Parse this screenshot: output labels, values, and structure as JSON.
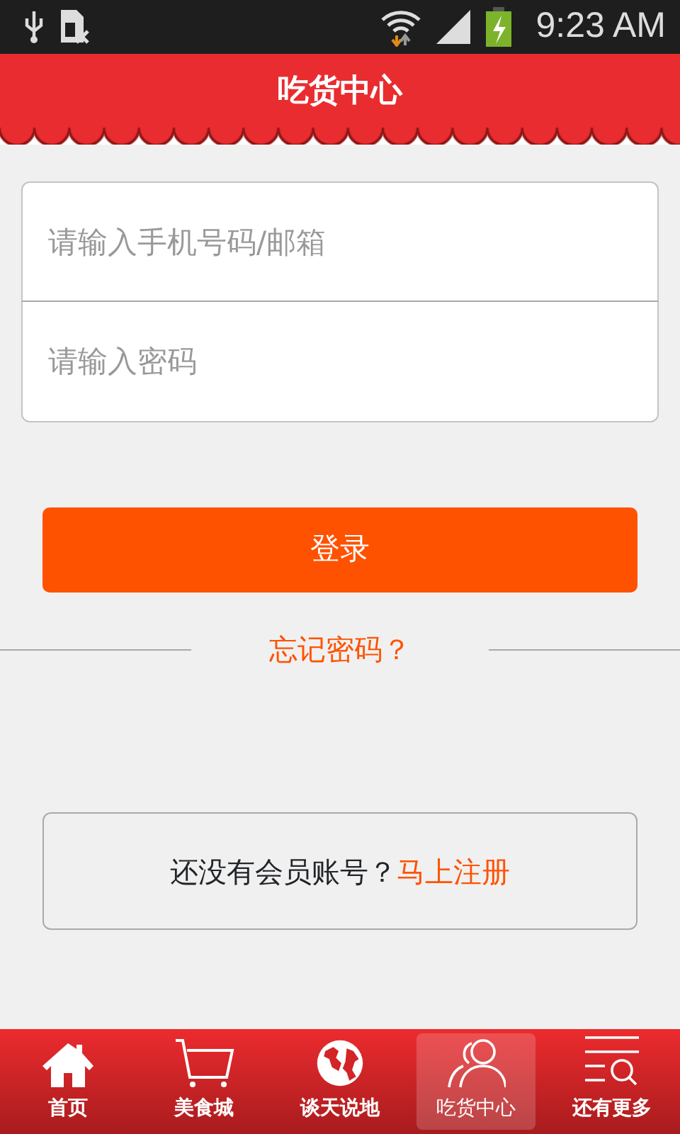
{
  "status_bar": {
    "time": "9:23 AM"
  },
  "header": {
    "title": "吃货中心"
  },
  "login_form": {
    "fields": [
      {
        "placeholder": "请输入手机号码/邮箱"
      },
      {
        "placeholder": "请输入密码"
      }
    ],
    "login_button": "登录",
    "forgot_link": "忘记密码？"
  },
  "register": {
    "prompt": "还没有会员账号？",
    "link": "马上注册"
  },
  "tabs": [
    {
      "label": "首页",
      "selected": false
    },
    {
      "label": "美食城",
      "selected": false
    },
    {
      "label": "谈天说地",
      "selected": false
    },
    {
      "label": "吃货中心",
      "selected": true
    },
    {
      "label": "还有更多",
      "selected": false
    }
  ]
}
